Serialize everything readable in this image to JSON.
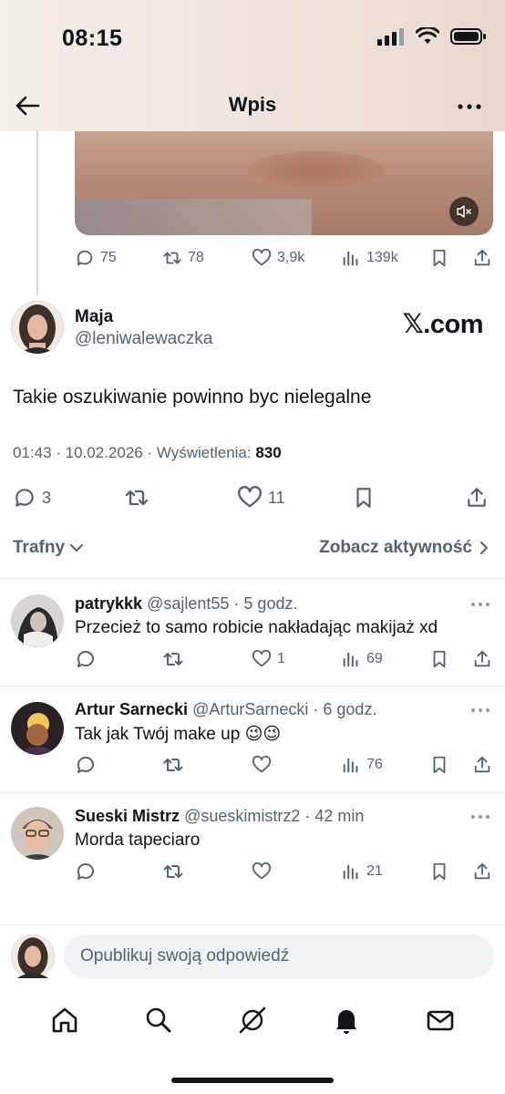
{
  "status_bar": {
    "time": "08:15"
  },
  "header": {
    "title": "Wpis"
  },
  "parent_tweet": {
    "stats": {
      "replies": "75",
      "reposts": "78",
      "likes": "3,9k",
      "views": "139k"
    }
  },
  "tweet": {
    "author_name": "Maja",
    "author_handle": "@leniwalewaczka",
    "watermark": "𝕏.com",
    "text": "Takie oszukiwanie powinno byc nielegalne",
    "meta_time": "01:43 · 10.02.2026 · Wyświetlenia: ",
    "meta_views": "830",
    "stats": {
      "replies": "3",
      "likes": "11"
    }
  },
  "filter": {
    "sort_label": "Trafny",
    "activity_label": "Zobacz aktywność"
  },
  "replies": [
    {
      "name": "patrykkk",
      "handle": "@sajlent55",
      "time": "· 5 godz.",
      "text": "Przecież to samo robicie nakładając makijaż xd",
      "likes": "1",
      "views": "69"
    },
    {
      "name": "Artur Sarnecki",
      "handle": "@ArturSarnecki",
      "time": "· 6 godz.",
      "text": "Tak jak Twój make up 😉😉",
      "likes": "",
      "views": "76"
    },
    {
      "name": "Sueski Mistrz",
      "handle": "@sueskimistrz2",
      "time": "· 42 min",
      "text": "Morda tapeciaro",
      "likes": "",
      "views": "21"
    }
  ],
  "compose": {
    "placeholder": "Opublikuj swoją odpowiedź"
  },
  "icons": [
    "back-arrow-icon",
    "more-icon",
    "reply-icon",
    "repost-icon",
    "like-icon",
    "views-icon",
    "bookmark-icon",
    "share-icon",
    "home-icon",
    "search-icon",
    "grok-icon",
    "bell-icon",
    "mail-icon"
  ]
}
